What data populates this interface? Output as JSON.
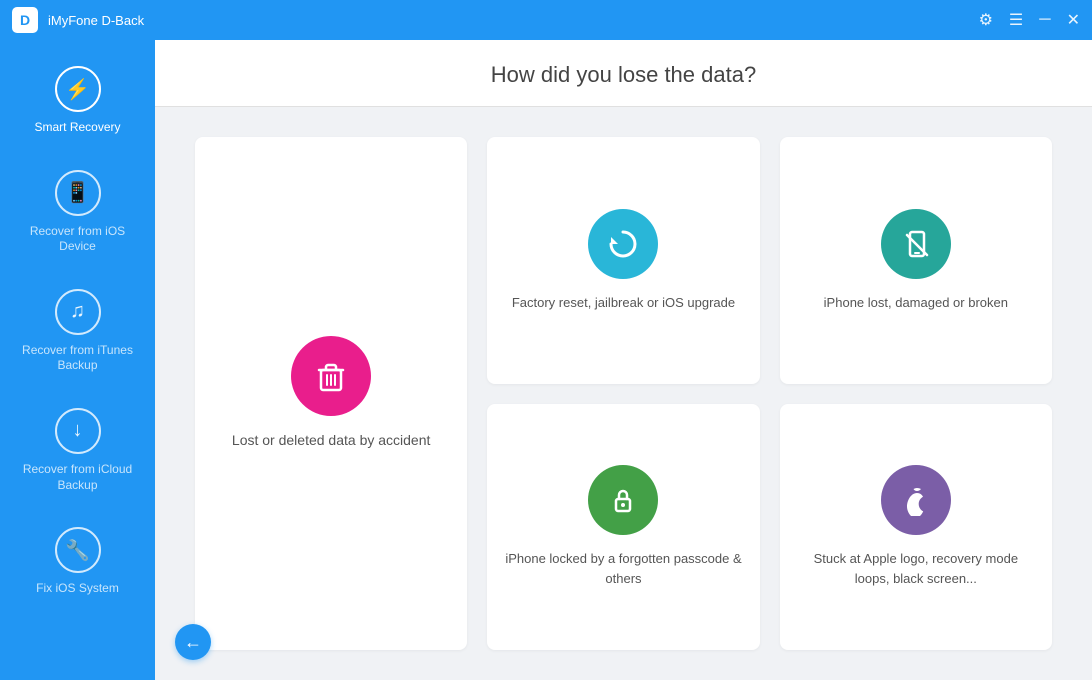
{
  "titlebar": {
    "logo": "D",
    "title": "iMyFone D-Back",
    "settings_icon": "⚙",
    "menu_icon": "☰",
    "minimize_icon": "─",
    "close_icon": "✕"
  },
  "sidebar": {
    "items": [
      {
        "id": "smart-recovery",
        "label": "Smart Recovery",
        "icon": "⚡",
        "active": true
      },
      {
        "id": "recover-ios",
        "label": "Recover from\niOS Device",
        "icon": "📱",
        "active": false
      },
      {
        "id": "recover-itunes",
        "label": "Recover from\niTunes Backup",
        "icon": "♪",
        "active": false
      },
      {
        "id": "recover-icloud",
        "label": "Recover from\niCloud Backup",
        "icon": "↓",
        "active": false
      },
      {
        "id": "fix-ios",
        "label": "Fix iOS System",
        "icon": "🔧",
        "active": false
      }
    ]
  },
  "main": {
    "heading": "How did you lose the data?",
    "cards": [
      {
        "id": "lost-deleted",
        "label": "Lost or deleted data by accident",
        "icon": "🗑",
        "icon_color": "icon-pink",
        "span_rows": true
      },
      {
        "id": "factory-reset",
        "label": "Factory reset, jailbreak or iOS upgrade",
        "icon": "↺",
        "icon_color": "icon-blue",
        "span_rows": false
      },
      {
        "id": "iphone-lost",
        "label": "iPhone lost, damaged or broken",
        "icon": "📵",
        "icon_color": "icon-teal",
        "span_rows": false
      },
      {
        "id": "iphone-locked",
        "label": "iPhone locked by a forgotten passcode & others",
        "icon": "🔒",
        "icon_color": "icon-green",
        "span_rows": false
      },
      {
        "id": "apple-logo",
        "label": "Stuck at Apple logo, recovery mode loops, black screen...",
        "icon": "",
        "icon_color": "icon-purple",
        "span_rows": false
      }
    ],
    "back_label": "←"
  }
}
